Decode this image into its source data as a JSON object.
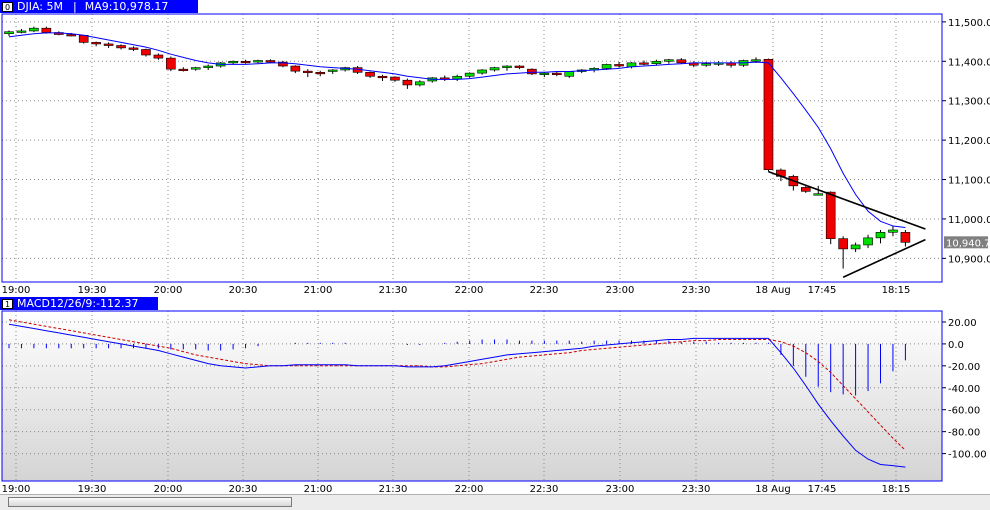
{
  "price_panel": {
    "index_label": "0",
    "symbol_label": "DJIA: 5M",
    "ma_label": "MA9:10,978.17",
    "current_price_label": "10,940.7"
  },
  "macd_panel": {
    "index_label": "1",
    "label": "MACD12/26/9:-112.37"
  },
  "colors": {
    "up": "#00dd00",
    "down": "#ee0000",
    "ma": "#0000ff",
    "signal": "#cc0000",
    "trendline": "#000000",
    "grid": "#888888",
    "frame": "#0000ff",
    "macd_bg_top": "#ffffff",
    "macd_bg_bottom": "#d4d4d4"
  },
  "chart_data": [
    {
      "type": "candlestick",
      "title": "DJIA: 5M",
      "series_ma_name": "MA9",
      "x_tick_labels": [
        "19:00",
        "19:30",
        "20:00",
        "20:30",
        "21:00",
        "21:30",
        "22:00",
        "22:30",
        "23:00",
        "23:30",
        "18 Aug",
        "17:45",
        "18:15"
      ],
      "y_tick_labels": [
        "11,500.0",
        "11,400.0",
        "11,300.0",
        "11,200.0",
        "11,100.0",
        "11,000.0",
        "10,900.0"
      ],
      "ylim": [
        10840,
        11520
      ],
      "grid": true,
      "candles": [
        {
          "o": 11470,
          "h": 11478,
          "l": 11464,
          "c": 11475
        },
        {
          "o": 11475,
          "h": 11482,
          "l": 11471,
          "c": 11477
        },
        {
          "o": 11477,
          "h": 11488,
          "l": 11474,
          "c": 11484
        },
        {
          "o": 11484,
          "h": 11488,
          "l": 11470,
          "c": 11473
        },
        {
          "o": 11473,
          "h": 11476,
          "l": 11466,
          "c": 11468
        },
        {
          "o": 11468,
          "h": 11472,
          "l": 11463,
          "c": 11466
        },
        {
          "o": 11466,
          "h": 11467,
          "l": 11445,
          "c": 11448
        },
        {
          "o": 11448,
          "h": 11450,
          "l": 11438,
          "c": 11444
        },
        {
          "o": 11444,
          "h": 11448,
          "l": 11434,
          "c": 11440
        },
        {
          "o": 11440,
          "h": 11443,
          "l": 11430,
          "c": 11434
        },
        {
          "o": 11434,
          "h": 11438,
          "l": 11426,
          "c": 11430
        },
        {
          "o": 11430,
          "h": 11432,
          "l": 11412,
          "c": 11416
        },
        {
          "o": 11416,
          "h": 11420,
          "l": 11404,
          "c": 11408
        },
        {
          "o": 11408,
          "h": 11412,
          "l": 11375,
          "c": 11380
        },
        {
          "o": 11380,
          "h": 11385,
          "l": 11374,
          "c": 11378
        },
        {
          "o": 11380,
          "h": 11386,
          "l": 11376,
          "c": 11384
        },
        {
          "o": 11384,
          "h": 11392,
          "l": 11378,
          "c": 11388
        },
        {
          "o": 11388,
          "h": 11398,
          "l": 11384,
          "c": 11396
        },
        {
          "o": 11396,
          "h": 11402,
          "l": 11392,
          "c": 11400
        },
        {
          "o": 11400,
          "h": 11404,
          "l": 11394,
          "c": 11398
        },
        {
          "o": 11398,
          "h": 11404,
          "l": 11395,
          "c": 11402
        },
        {
          "o": 11402,
          "h": 11405,
          "l": 11395,
          "c": 11398
        },
        {
          "o": 11398,
          "h": 11401,
          "l": 11385,
          "c": 11388
        },
        {
          "o": 11388,
          "h": 11390,
          "l": 11370,
          "c": 11375
        },
        {
          "o": 11375,
          "h": 11380,
          "l": 11360,
          "c": 11372
        },
        {
          "o": 11372,
          "h": 11376,
          "l": 11362,
          "c": 11370
        },
        {
          "o": 11376,
          "h": 11380,
          "l": 11368,
          "c": 11378
        },
        {
          "o": 11378,
          "h": 11386,
          "l": 11374,
          "c": 11384
        },
        {
          "o": 11384,
          "h": 11388,
          "l": 11368,
          "c": 11372
        },
        {
          "o": 11372,
          "h": 11374,
          "l": 11358,
          "c": 11362
        },
        {
          "o": 11362,
          "h": 11366,
          "l": 11350,
          "c": 11360
        },
        {
          "o": 11360,
          "h": 11362,
          "l": 11348,
          "c": 11352
        },
        {
          "o": 11352,
          "h": 11356,
          "l": 11330,
          "c": 11340
        },
        {
          "o": 11340,
          "h": 11352,
          "l": 11336,
          "c": 11348
        },
        {
          "o": 11350,
          "h": 11360,
          "l": 11346,
          "c": 11358
        },
        {
          "o": 11358,
          "h": 11364,
          "l": 11350,
          "c": 11355
        },
        {
          "o": 11355,
          "h": 11366,
          "l": 11350,
          "c": 11362
        },
        {
          "o": 11362,
          "h": 11372,
          "l": 11358,
          "c": 11370
        },
        {
          "o": 11370,
          "h": 11380,
          "l": 11366,
          "c": 11378
        },
        {
          "o": 11378,
          "h": 11386,
          "l": 11374,
          "c": 11384
        },
        {
          "o": 11384,
          "h": 11390,
          "l": 11376,
          "c": 11388
        },
        {
          "o": 11388,
          "h": 11390,
          "l": 11380,
          "c": 11384
        },
        {
          "o": 11380,
          "h": 11382,
          "l": 11365,
          "c": 11368
        },
        {
          "o": 11368,
          "h": 11372,
          "l": 11360,
          "c": 11370
        },
        {
          "o": 11370,
          "h": 11373,
          "l": 11362,
          "c": 11366
        },
        {
          "o": 11362,
          "h": 11375,
          "l": 11358,
          "c": 11374
        },
        {
          "o": 11374,
          "h": 11380,
          "l": 11370,
          "c": 11378
        },
        {
          "o": 11378,
          "h": 11385,
          "l": 11372,
          "c": 11382
        },
        {
          "o": 11382,
          "h": 11394,
          "l": 11378,
          "c": 11392
        },
        {
          "o": 11392,
          "h": 11398,
          "l": 11384,
          "c": 11388
        },
        {
          "o": 11386,
          "h": 11398,
          "l": 11382,
          "c": 11396
        },
        {
          "o": 11396,
          "h": 11402,
          "l": 11390,
          "c": 11394
        },
        {
          "o": 11394,
          "h": 11404,
          "l": 11390,
          "c": 11400
        },
        {
          "o": 11400,
          "h": 11406,
          "l": 11394,
          "c": 11404
        },
        {
          "o": 11404,
          "h": 11408,
          "l": 11394,
          "c": 11396
        },
        {
          "o": 11396,
          "h": 11400,
          "l": 11385,
          "c": 11390
        },
        {
          "o": 11390,
          "h": 11398,
          "l": 11386,
          "c": 11394
        },
        {
          "o": 11394,
          "h": 11400,
          "l": 11388,
          "c": 11396
        },
        {
          "o": 11396,
          "h": 11400,
          "l": 11384,
          "c": 11390
        },
        {
          "o": 11390,
          "h": 11404,
          "l": 11386,
          "c": 11402
        },
        {
          "o": 11402,
          "h": 11410,
          "l": 11396,
          "c": 11404
        },
        {
          "o": 11405,
          "h": 11407,
          "l": 11120,
          "c": 11125
        },
        {
          "o": 11124,
          "h": 11128,
          "l": 11096,
          "c": 11108
        },
        {
          "o": 11108,
          "h": 11112,
          "l": 11072,
          "c": 11084
        },
        {
          "o": 11080,
          "h": 11084,
          "l": 11066,
          "c": 11070
        },
        {
          "o": 11064,
          "h": 11084,
          "l": 11060,
          "c": 11064
        },
        {
          "o": 11068,
          "h": 11070,
          "l": 10936,
          "c": 10950
        },
        {
          "o": 10950,
          "h": 10956,
          "l": 10874,
          "c": 10924
        },
        {
          "o": 10924,
          "h": 10940,
          "l": 10916,
          "c": 10934
        },
        {
          "o": 10934,
          "h": 10960,
          "l": 10926,
          "c": 10952
        },
        {
          "o": 10952,
          "h": 10972,
          "l": 10938,
          "c": 10966
        },
        {
          "o": 10966,
          "h": 10982,
          "l": 10956,
          "c": 10972
        },
        {
          "o": 10966,
          "h": 10972,
          "l": 10930,
          "c": 10940.7
        }
      ],
      "ma": [
        11462,
        11466,
        11470,
        11472,
        11472,
        11470,
        11466,
        11460,
        11454,
        11448,
        11442,
        11436,
        11428,
        11418,
        11410,
        11402,
        11396,
        11392,
        11392,
        11392,
        11394,
        11396,
        11396,
        11394,
        11390,
        11386,
        11384,
        11382,
        11380,
        11376,
        11372,
        11368,
        11362,
        11358,
        11354,
        11354,
        11354,
        11356,
        11360,
        11364,
        11368,
        11370,
        11372,
        11372,
        11374,
        11374,
        11376,
        11378,
        11380,
        11382,
        11386,
        11388,
        11390,
        11392,
        11394,
        11396,
        11396,
        11396,
        11396,
        11396,
        11398,
        11396,
        11358,
        11318,
        11276,
        11232,
        11178,
        11116,
        11062,
        11020,
        10994,
        10982,
        10978.17
      ],
      "trendlines": [
        {
          "x1": 61,
          "y1": 11120,
          "x2": 72,
          "y2": 10982
        },
        {
          "x1": 67,
          "y1": 10852,
          "x2": 72,
          "y2": 10940
        }
      ]
    },
    {
      "type": "line",
      "title": "MACD12/26/9",
      "x_tick_labels": [
        "19:00",
        "19:30",
        "20:00",
        "20:30",
        "21:00",
        "21:30",
        "22:00",
        "22:30",
        "23:00",
        "23:30",
        "18 Aug",
        "17:45",
        "18:15"
      ],
      "y_tick_labels": [
        "20.00",
        "0.0",
        "-20.00",
        "-40.00",
        "-60.00",
        "-80.00",
        "-100.00"
      ],
      "ylim": [
        -125,
        30
      ],
      "macd": [
        18,
        16,
        14,
        12,
        10,
        8,
        6,
        4,
        2,
        0,
        -2,
        -4,
        -6,
        -9,
        -12,
        -15,
        -18,
        -20,
        -21,
        -22,
        -21,
        -20,
        -20,
        -19,
        -19,
        -19,
        -19,
        -19,
        -20,
        -20,
        -20,
        -20,
        -21,
        -21,
        -21,
        -20,
        -18,
        -16,
        -14,
        -12,
        -10,
        -9,
        -8,
        -7,
        -6,
        -5,
        -4,
        -2,
        -1,
        0,
        1,
        2,
        3,
        4,
        4,
        5,
        5,
        5,
        5,
        5,
        5,
        5,
        -8,
        -22,
        -38,
        -55,
        -70,
        -84,
        -97,
        -105,
        -110,
        -111,
        -112.37
      ],
      "signal": [
        22,
        20,
        18,
        16,
        14,
        12,
        10,
        8,
        6,
        4,
        2,
        0,
        -2,
        -4,
        -7,
        -10,
        -12,
        -14,
        -16,
        -18,
        -19,
        -20,
        -20,
        -20,
        -20,
        -20,
        -20,
        -20,
        -20,
        -20,
        -20,
        -20,
        -20,
        -20,
        -21,
        -21,
        -20,
        -19,
        -18,
        -16,
        -14,
        -12,
        -11,
        -10,
        -9,
        -8,
        -6,
        -5,
        -4,
        -3,
        -2,
        -1,
        0,
        1,
        2,
        3,
        3,
        4,
        4,
        4,
        4,
        4,
        2,
        -2,
        -8,
        -16,
        -26,
        -38,
        -50,
        -62,
        -74,
        -86,
        -97
      ],
      "histogram": [
        -4,
        -4,
        -4,
        -4,
        -4,
        -4,
        -4,
        -4,
        -4,
        -4,
        -4,
        -4,
        -4,
        -5,
        -5,
        -5,
        -6,
        -6,
        -5,
        -4,
        -2,
        0,
        0,
        1,
        1,
        1,
        1,
        1,
        0,
        0,
        0,
        0,
        -1,
        -1,
        0,
        1,
        2,
        3,
        4,
        4,
        4,
        3,
        3,
        3,
        3,
        3,
        2,
        3,
        3,
        3,
        3,
        3,
        3,
        3,
        2,
        2,
        2,
        1,
        1,
        1,
        1,
        1,
        -10,
        -20,
        -30,
        -39,
        -44,
        -46,
        -47,
        -43,
        -36,
        -25,
        -15
      ],
      "series": [
        {
          "name": "MACD",
          "color": "#0000ff"
        },
        {
          "name": "Signal",
          "color": "#cc0000"
        },
        {
          "name": "Histogram",
          "color": "#0000ff"
        }
      ]
    }
  ]
}
